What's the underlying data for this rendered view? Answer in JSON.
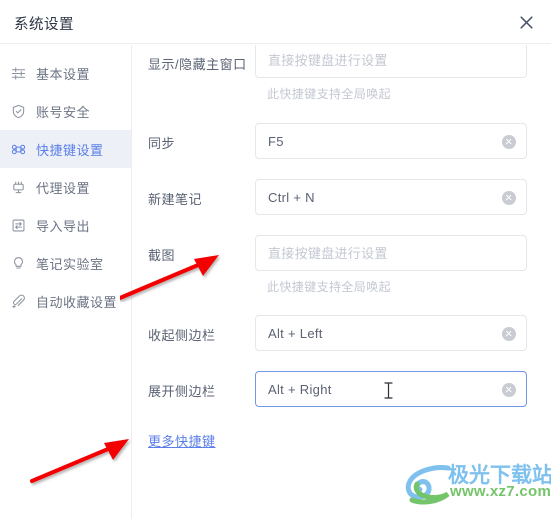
{
  "window": {
    "title": "系统设置",
    "close_icon": "close-icon"
  },
  "sidebar": {
    "items": [
      {
        "label": "基本设置",
        "icon": "sliders-icon",
        "active": false
      },
      {
        "label": "账号安全",
        "icon": "shield-icon",
        "active": false
      },
      {
        "label": "快捷键设置",
        "icon": "command-key-icon",
        "active": true
      },
      {
        "label": "代理设置",
        "icon": "network-plug-icon",
        "active": false
      },
      {
        "label": "导入导出",
        "icon": "import-export-icon",
        "active": false
      },
      {
        "label": "笔记实验室",
        "icon": "lightbulb-icon",
        "active": false
      },
      {
        "label": "自动收藏设置",
        "icon": "paperclip-icon",
        "active": false
      }
    ]
  },
  "shortcuts": {
    "rows": [
      {
        "label": "显示/隐藏主窗口",
        "value": "",
        "placeholder": "直接按键盘进行设置",
        "hint": "此快捷键支持全局唤起",
        "has_clear": false,
        "focused": false
      },
      {
        "label": "同步",
        "value": "F5",
        "placeholder": "",
        "hint": "",
        "has_clear": true,
        "focused": false
      },
      {
        "label": "新建笔记",
        "value": "Ctrl + N",
        "placeholder": "",
        "hint": "",
        "has_clear": true,
        "focused": false
      },
      {
        "label": "截图",
        "value": "",
        "placeholder": "直接按键盘进行设置",
        "hint": "此快捷键支持全局唤起",
        "has_clear": false,
        "focused": false
      },
      {
        "label": "收起侧边栏",
        "value": "Alt + Left",
        "placeholder": "",
        "hint": "",
        "has_clear": true,
        "focused": false
      },
      {
        "label": "展开侧边栏",
        "value": "Alt + Right",
        "placeholder": "",
        "hint": "",
        "has_clear": true,
        "focused": true
      }
    ],
    "more_link": "更多快捷键"
  },
  "watermark": {
    "title": "极光下载站",
    "url": "www.xz7.com"
  },
  "colors": {
    "accent": "#5b7fe8",
    "active_bg": "#edf1f7",
    "label": "#5a6274",
    "placeholder": "#c3c8d2",
    "border": "#e4e7ec",
    "focus_border": "#7296ec",
    "annotation": "#f40000",
    "wm_title": "#7ec1ee",
    "wm_url": "#74c46a"
  }
}
